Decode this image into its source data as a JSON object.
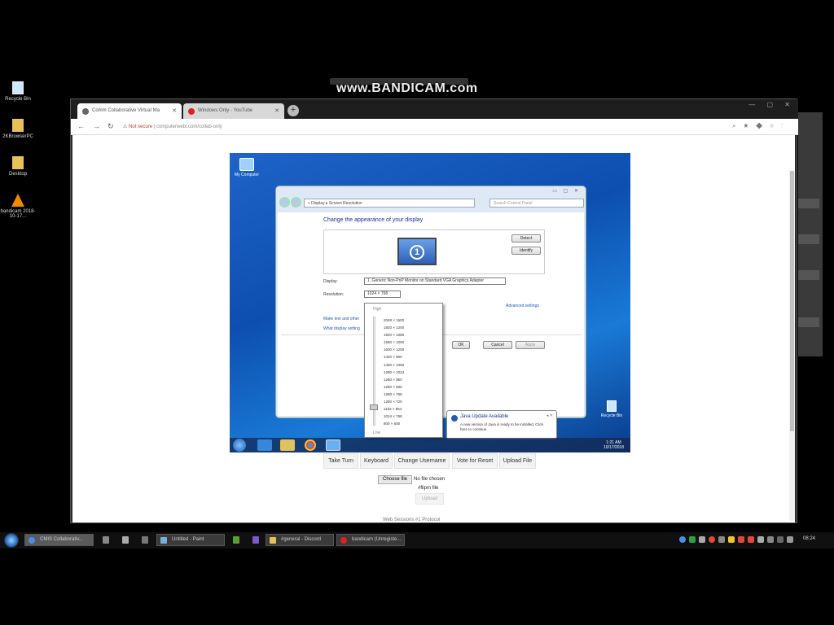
{
  "watermark": {
    "text": "www.BANDICAM.com"
  },
  "desktop_icons": [
    {
      "label": "Recycle Bin",
      "icon": "recycle-bin-icon"
    },
    {
      "label": "2KBrowserPC",
      "icon": "folder-icon"
    },
    {
      "label": "Desktop",
      "icon": "folder-icon"
    },
    {
      "label": "bandicam 2018-10-17...",
      "icon": "vlc-icon"
    }
  ],
  "browser": {
    "tabs": [
      {
        "title": "Comm Collaborative Virtual Ma",
        "active": true
      },
      {
        "title": "Windows Only - YouTube",
        "active": false
      }
    ],
    "new_tab": "+",
    "address": {
      "security": "Not secure",
      "url": "computerwebi.com/collab-only"
    }
  },
  "vm": {
    "desktop": {
      "my_computer": "My Computer",
      "recycle_bin": "Recycle Bin"
    },
    "dialog": {
      "breadcrumb": "« Display ▸ Screen Resolution",
      "search_placeholder": "Search Control Panel",
      "heading": "Change the appearance of your display",
      "detect": "Detect",
      "identify": "Identify",
      "monitor_number": "1",
      "display_label": "Display:",
      "display_value": "1. Generic Non-PnP Monitor on Standard VGA Graphics Adapter",
      "resolution_label": "Resolution:",
      "resolution_value": "1024 × 768",
      "advanced": "Advanced settings",
      "link1": "Make text and other",
      "link2": "What display setting",
      "ok": "OK",
      "cancel": "Cancel",
      "apply": "Apply"
    },
    "resolution_dropdown": {
      "high": "High",
      "low": "Low",
      "options": [
        "2048 × 1600",
        "1920 × 1200",
        "1920 × 1080",
        "1680 × 1050",
        "1600 × 1200",
        "1440 × 900",
        "1400 × 1050",
        "1280 × 1024",
        "1280 × 960",
        "1280 × 800",
        "1280 × 768",
        "1280 × 720",
        "1152 × 864",
        "1024 × 768",
        "800 × 600"
      ]
    },
    "java_balloon": {
      "title": "Java Update Available",
      "body": "A new version of Java is ready to be installed. Click here to continue."
    },
    "clock": {
      "time": "1:21 AM",
      "date": "10/17/2018"
    }
  },
  "app_buttons": [
    "Take Turn",
    "Keyboard",
    "Change Username",
    "Vote for Reset",
    "Upload File"
  ],
  "file_input": {
    "button": "Choose file",
    "status": "No file chosen",
    "flip_file": "#flipm file"
  },
  "upload_button": "Upload",
  "cutoff_text": "Web Sessions   #1 Protocol",
  "taskbar": {
    "items": [
      {
        "label": "CMIS Collaborativ...",
        "icon": "chrome-icon"
      },
      {
        "label": "Untitled - Paint",
        "icon": "paint-icon"
      },
      {
        "label": "#general - Discord",
        "icon": "discord-icon"
      },
      {
        "label": "bandicam (Unregiste...",
        "icon": "bandicam-icon"
      }
    ],
    "clock": "08:24"
  }
}
